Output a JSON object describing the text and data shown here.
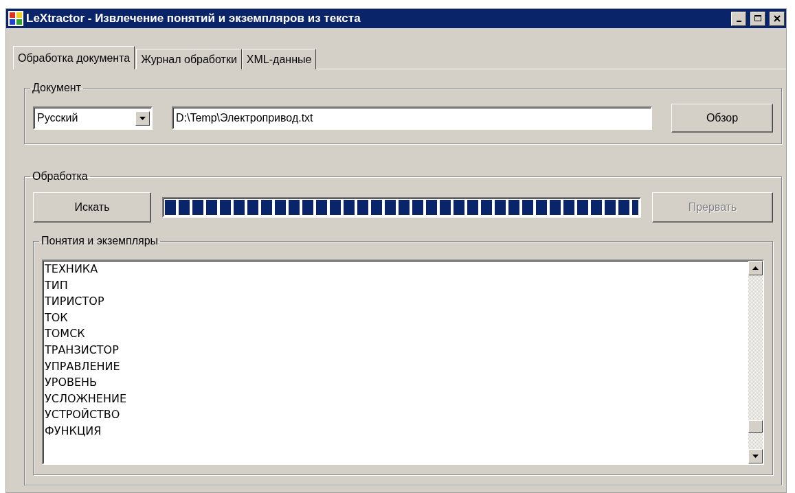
{
  "window": {
    "title": "LeXtractor - Извлечение понятий и экземпляров из текста"
  },
  "tabs": [
    {
      "label": "Обработка документа",
      "selected": true
    },
    {
      "label": "Журнал обработки",
      "selected": false
    },
    {
      "label": "XML-данные",
      "selected": false
    }
  ],
  "document_group": {
    "title": "Документ",
    "language": "Русский",
    "path": "D:\\Temp\\Электропривод.txt",
    "browse_button": "Обзор"
  },
  "processing_group": {
    "title": "Обработка",
    "search_button": "Искать",
    "progress": {
      "level": 1
    },
    "abort_button": {
      "label": "Прервать",
      "disabled": true
    },
    "results_group": {
      "title": "Понятия и экземпляры",
      "items": [
        "ТЕХНИКА",
        "ТИП",
        "ТИРИСТОР",
        "ТОК",
        "ТОМСК",
        "ТРАНЗИСТОР",
        "УПРАВЛЕНИЕ",
        "УРОВЕНЬ",
        "УСЛОЖНЕНИЕ",
        "УСТРОЙСТВО",
        "ФУНКЦИЯ"
      ]
    }
  }
}
